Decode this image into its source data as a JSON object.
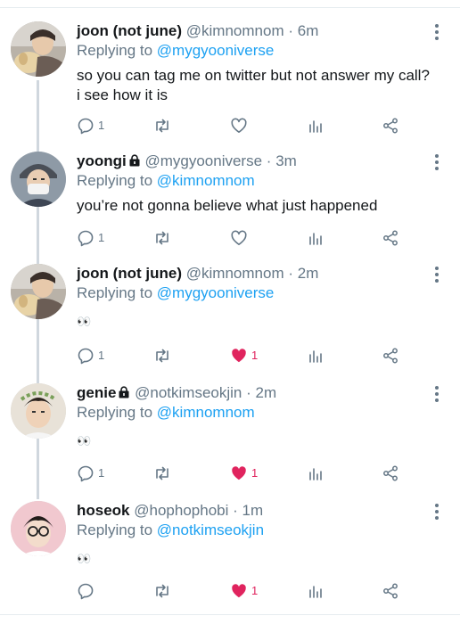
{
  "colors": {
    "accent": "#1da1f2",
    "like": "#e0245e",
    "muted": "#657786"
  },
  "tweets": [
    {
      "name": "joon (not june)",
      "locked": false,
      "handle": "@kimnomnom",
      "sep": "·",
      "time": "6m",
      "replying_prefix": "Replying to",
      "replying_to": "@mygyooniverse",
      "text": "so you can tag me on twitter but not answer my call? i see how it is",
      "reply_count": "1",
      "retweet_count": "",
      "like_count": "",
      "liked": false,
      "avatar": "joon-dog-avatar"
    },
    {
      "name": "yoongi",
      "locked": true,
      "handle": "@mygyooniverse",
      "sep": "·",
      "time": "3m",
      "replying_prefix": "Replying to",
      "replying_to": "@kimnomnom",
      "text": "you’re not gonna believe what just happened",
      "reply_count": "1",
      "retweet_count": "",
      "like_count": "",
      "liked": false,
      "avatar": "yoongi-mask-avatar"
    },
    {
      "name": "joon (not june)",
      "locked": false,
      "handle": "@kimnomnom",
      "sep": "·",
      "time": "2m",
      "replying_prefix": "Replying to",
      "replying_to": "@mygyooniverse",
      "text": "👀",
      "reply_count": "1",
      "retweet_count": "",
      "like_count": "1",
      "liked": true,
      "avatar": "joon-dog-avatar"
    },
    {
      "name": "genie",
      "locked": true,
      "handle": "@notkimseokjin",
      "sep": "·",
      "time": "2m",
      "replying_prefix": "Replying to",
      "replying_to": "@kimnomnom",
      "text": "👀",
      "reply_count": "1",
      "retweet_count": "",
      "like_count": "1",
      "liked": true,
      "avatar": "genie-wreath-avatar"
    },
    {
      "name": "hoseok",
      "locked": false,
      "handle": "@hophophobi",
      "sep": "·",
      "time": "1m",
      "replying_prefix": "Replying to",
      "replying_to": "@notkimseokjin",
      "text": "👀",
      "reply_count": "",
      "retweet_count": "",
      "like_count": "1",
      "liked": true,
      "avatar": "hoseok-glasses-avatar"
    }
  ]
}
